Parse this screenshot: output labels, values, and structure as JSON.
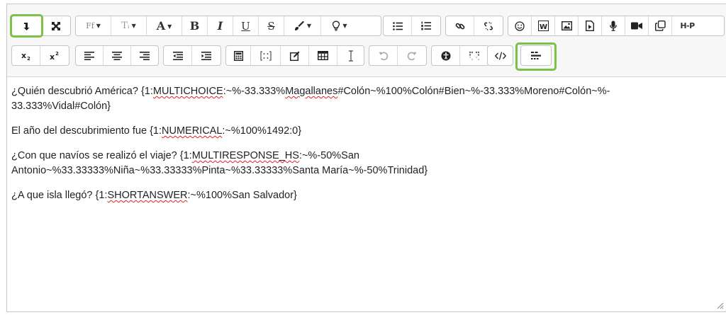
{
  "toolbar": {
    "font_family_label": "Ff",
    "font_size_label": "Tᵢ",
    "font_color_label": "A",
    "bold_label": "B",
    "italic_label": "I",
    "underline_label": "U",
    "strike_label": "S",
    "h5p_label": "H-P",
    "highlight_color": "#7cc246"
  },
  "content": {
    "q1_prefix": "¿Quién descubrió América? {1:",
    "q1_keyword": "MULTICHOICE",
    "q1_mid": ":~%-33.333%",
    "q1_keyword2": "Magallanes",
    "q1_suffix": "#Colón~%100%Colón#Bien~%-33.333%Moreno#Colón~%-",
    "q1_line2": "33.333%Vidal#Colón}",
    "q2_prefix": "El año del descubrimiento fue {1:",
    "q2_keyword": "NUMERICAL",
    "q2_suffix": ":~%100%1492:0}",
    "q3_prefix": "¿Con que navíos se realizó el viaje? {1:",
    "q3_keyword": "MULTIRESPONSE_HS",
    "q3_suffix": ":~%-50%San",
    "q3_line2": "Antonio~%33.33333%Niña~%33.33333%Pinta~%33.33333%Santa María~%-50%Trinidad}",
    "q4_prefix": "¿A que isla llegó? {1:",
    "q4_keyword": "SHORTANSWER",
    "q4_suffix": ":~%100%San Salvador}"
  }
}
